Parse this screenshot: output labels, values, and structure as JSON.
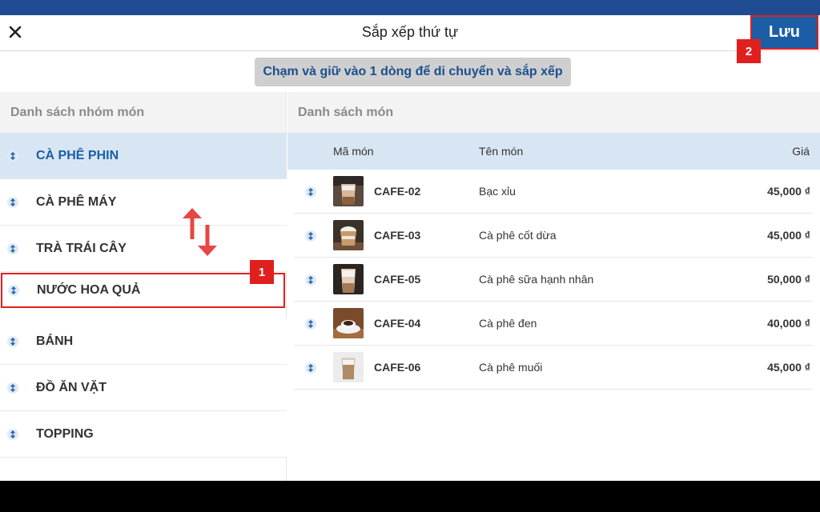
{
  "header": {
    "title": "Sắp xếp thứ tự",
    "save_label": "Lưu"
  },
  "hint": "Chạm và giữ vào 1 dòng để di chuyển và sắp xếp",
  "annotations": {
    "badge_1": "1",
    "badge_2": "2"
  },
  "groups": {
    "header": "Danh sách nhóm món",
    "items": [
      {
        "label": "CÀ PHÊ PHIN",
        "selected": true
      },
      {
        "label": "CÀ PHÊ MÁY"
      },
      {
        "label": "TRÀ TRÁI CÂY"
      },
      {
        "label": "NƯỚC HOA QUẢ",
        "dragging": true
      },
      {
        "label": "BÁNH"
      },
      {
        "label": "ĐỒ ĂN VẶT"
      },
      {
        "label": "TOPPING"
      }
    ]
  },
  "dishes": {
    "header": "Danh sách món",
    "columns": {
      "code": "Mã món",
      "name": "Tên món",
      "price": "Giá"
    },
    "rows": [
      {
        "code": "CAFE-02",
        "name": "Bạc xỉu",
        "price": "45,000 ₫"
      },
      {
        "code": "CAFE-03",
        "name": "Cà phê cốt dừa",
        "price": "45,000 ₫"
      },
      {
        "code": "CAFE-05",
        "name": "Cà phê sữa hạnh nhân",
        "price": "50,000 ₫"
      },
      {
        "code": "CAFE-04",
        "name": "Cà phê đen",
        "price": "40,000 ₫"
      },
      {
        "code": "CAFE-06",
        "name": "Cà phê muối",
        "price": "45,000 ₫"
      }
    ]
  },
  "colors": {
    "primary": "#1b5ea6",
    "selected_row": "#d8e6f3",
    "annotation_red": "#e0201e",
    "status_bar": "#1f4b92"
  }
}
